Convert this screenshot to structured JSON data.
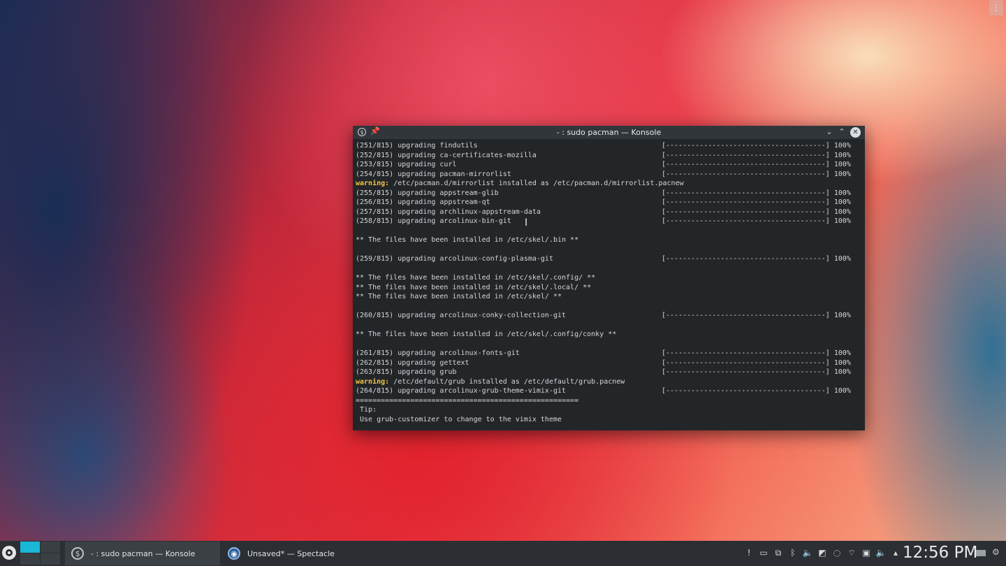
{
  "window": {
    "title": "- : sudo pacman — Konsole",
    "app_icon": "$",
    "pin_icon": "📌",
    "minimize_glyph": "⌄",
    "maximize_glyph": "⌃",
    "close_glyph": "✕"
  },
  "terminal": {
    "lines": [
      {
        "text": "(251/815) upgrading findutils",
        "bar": "[--------------------------------------] 100%"
      },
      {
        "text": "(252/815) upgrading ca-certificates-mozilla",
        "bar": "[--------------------------------------] 100%"
      },
      {
        "text": "(253/815) upgrading curl",
        "bar": "[--------------------------------------] 100%"
      },
      {
        "text": "(254/815) upgrading pacman-mirrorlist",
        "bar": "[--------------------------------------] 100%"
      },
      {
        "warn": "warning:",
        "text": " /etc/pacman.d/mirrorlist installed as /etc/pacman.d/mirrorlist.pacnew"
      },
      {
        "text": "(255/815) upgrading appstream-glib",
        "bar": "[--------------------------------------] 100%"
      },
      {
        "text": "(256/815) upgrading appstream-qt",
        "bar": "[--------------------------------------] 100%"
      },
      {
        "text": "(257/815) upgrading archlinux-appstream-data",
        "bar": "[--------------------------------------] 100%"
      },
      {
        "text": "(258/815) upgrading arcolinux-bin-git",
        "bar": "[--------------------------------------] 100%"
      },
      {
        "text": ""
      },
      {
        "text": "** The files have been installed in /etc/skel/.bin **"
      },
      {
        "text": ""
      },
      {
        "text": "(259/815) upgrading arcolinux-config-plasma-git",
        "bar": "[--------------------------------------] 100%"
      },
      {
        "text": ""
      },
      {
        "text": "** The files have been installed in /etc/skel/.config/ **"
      },
      {
        "text": "** The files have been installed in /etc/skel/.local/ **"
      },
      {
        "text": "** The files have been installed in /etc/skel/ **"
      },
      {
        "text": ""
      },
      {
        "text": "(260/815) upgrading arcolinux-conky-collection-git",
        "bar": "[--------------------------------------] 100%"
      },
      {
        "text": ""
      },
      {
        "text": "** The files have been installed in /etc/skel/.config/conky **"
      },
      {
        "text": ""
      },
      {
        "text": "(261/815) upgrading arcolinux-fonts-git",
        "bar": "[--------------------------------------] 100%"
      },
      {
        "text": "(262/815) upgrading gettext",
        "bar": "[--------------------------------------] 100%"
      },
      {
        "text": "(263/815) upgrading grub",
        "bar": "[--------------------------------------] 100%"
      },
      {
        "warn": "warning:",
        "text": " /etc/default/grub installed as /etc/default/grub.pacnew"
      },
      {
        "text": "(264/815) upgrading arcolinux-grub-theme-vimix-git",
        "bar": "[--------------------------------------] 100%"
      },
      {
        "text": "====================================================="
      },
      {
        "text": " Tip:"
      },
      {
        "text": " Use grub-customizer to change to the vimix theme"
      }
    ]
  },
  "taskbar": {
    "tasks": [
      {
        "label": "- : sudo pacman — Konsole",
        "icon": "$"
      },
      {
        "label": "Unsaved* — Spectacle",
        "icon": "◉"
      }
    ],
    "tray_icons": [
      "!",
      "▭",
      "⧉",
      "ᛒ",
      "🔈",
      "◩",
      "◌",
      "⌔",
      "▣",
      "🔈",
      "▴"
    ],
    "clock": "12:56 PM",
    "hidden_menu_glyph": "⋮",
    "settings_glyph": "⚙"
  },
  "colors": {
    "warning": "#f5c242",
    "terminal_bg": "#232629",
    "accent": "#1ab8d6"
  }
}
